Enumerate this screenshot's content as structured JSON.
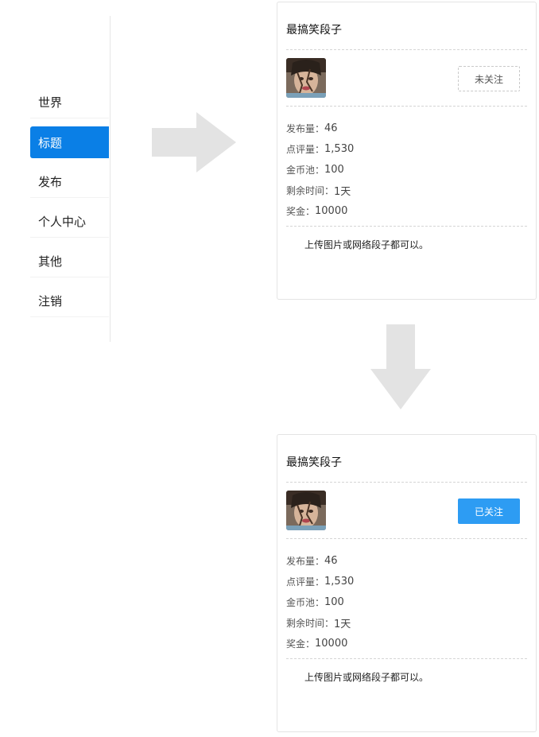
{
  "sidebar": {
    "items": [
      {
        "label": "世界"
      },
      {
        "label": "标题"
      },
      {
        "label": "发布"
      },
      {
        "label": "个人中心"
      },
      {
        "label": "其他"
      },
      {
        "label": "注销"
      }
    ],
    "active_index": 1
  },
  "card_before": {
    "title": "最搞笑段子",
    "follow_label": "未关注",
    "stats": [
      {
        "label": "发布量：",
        "value": "46"
      },
      {
        "label": "点评量：",
        "value": "1,530"
      },
      {
        "label": "金币池：",
        "value": "100"
      },
      {
        "label": "剩余时间：",
        "value": "1天"
      },
      {
        "label": "奖金：",
        "value": "10000"
      }
    ],
    "description": "上传图片或网络段子都可以。"
  },
  "card_after": {
    "title": "最搞笑段子",
    "follow_label": "已关注",
    "stats": [
      {
        "label": "发布量：",
        "value": "46"
      },
      {
        "label": "点评量：",
        "value": "1,530"
      },
      {
        "label": "金币池：",
        "value": "100"
      },
      {
        "label": "剩余时间：",
        "value": "1天"
      },
      {
        "label": "奖金：",
        "value": "10000"
      }
    ],
    "description": "上传图片或网络段子都可以。"
  },
  "colors": {
    "accent": "#0a7fe6",
    "followed_button": "#2d9cf3",
    "arrow": "#e3e3e3"
  },
  "icons": {
    "arrow_right": "arrow-right-icon",
    "arrow_down": "arrow-down-icon"
  }
}
